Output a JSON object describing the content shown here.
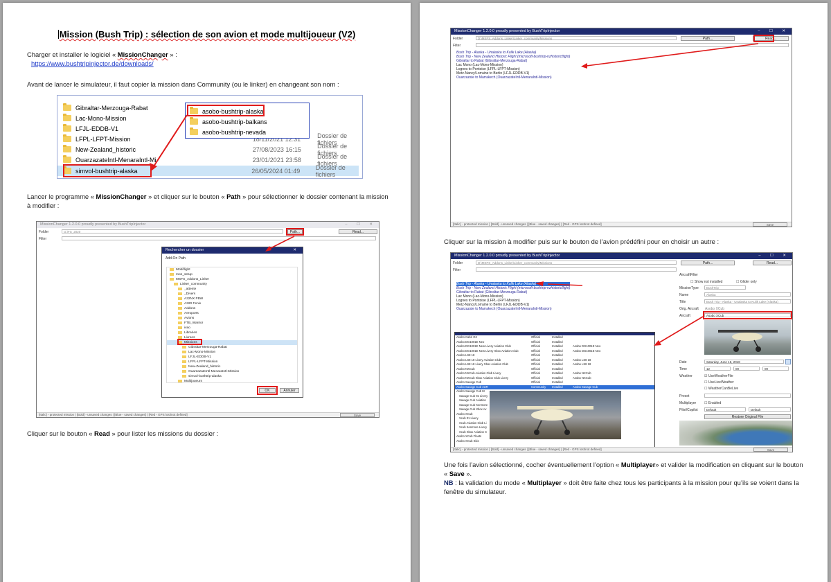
{
  "left_page": {
    "title": "Mission (Bush Trip) : sélection de son avion et mode multijoueur (V2)",
    "intro_prefix": "Charger et installer le logiciel « ",
    "intro_app": "MissionChanger",
    "intro_suffix": " » :",
    "download_url": "https://www.bushtripinjector.de/downloads/",
    "copy_instruction": "Avant de lancer le simulateur, il faut copier la mission dans Community (ou le linker) en changeant son nom :",
    "explorer_rows": [
      {
        "name": "Gibraltar-Merzouga-Rabat",
        "date": "",
        "type": ""
      },
      {
        "name": "Lac-Mono-Mission",
        "date": "",
        "type": ""
      },
      {
        "name": "LFJL-EDDB-V1",
        "date": "",
        "type": ""
      },
      {
        "name": "LFPL-LFPT-Mission",
        "date": "18/11/2021 12:31",
        "type": "Dossier de fichiers"
      },
      {
        "name": "New-Zealand_historic",
        "date": "27/08/2023 16:15",
        "type": "Dossier de fichiers"
      },
      {
        "name": "OuarzazateIntl-MenaraIntl-Mi",
        "date": "23/01/2021 23:58",
        "type": "Dossier de fichiers"
      },
      {
        "name": "simvol-bushtrip-alaska",
        "date": "26/05/2024 01:49",
        "type": "Dossier de fichiers"
      }
    ],
    "explorer_popup": [
      "asobo-bushtrip-alaska",
      "asobo-bushtrip-balkans",
      "asobo-bushtrip-nevada"
    ],
    "path_instruction_1": "Lancer le programme « ",
    "path_app": "MissionChanger",
    "path_instruction_2": " » et cliquer sur le bouton « ",
    "path_button": "Path",
    "path_instruction_3": " » pour sélectionner le dossier contenant la mission à modifier :",
    "read_instruction_1": "Cliquer sur le bouton « ",
    "read_button": "Read",
    "read_instruction_2": " » pour lister les missions du dossier :"
  },
  "app": {
    "window_title": "MissionChanger 1.2.0.0 proudly presented by BushTripInjector",
    "folder_label": "Folder",
    "filter_label": "Filter",
    "folder_value_1": "G:\\FS_2020",
    "folder_value_2": "D:\\MSFS_Addons_Linker\\Linker_community\\Missions",
    "path_btn": "Path...",
    "read_btn": "Read...",
    "save_btn": "Save",
    "status": "[Italic] - protected mission | [Bold] - unsaved changes | [Blue - saved changes] | [Red - GPS lost/not defined]",
    "missions": [
      "Bush Trip - Alaska - Unalaska to Kulik Lake (Alaska)",
      "Bush Trip - New Zealand Historic Flight (microsoft-bushtrip-nzhistoricflight)",
      "Gibraltar to Rabat (Gibraltar-Merzouga-Rabat)",
      "Lac Mono (Lac-Mono-Mission)",
      "Lognes to Pontoise (LFPL-LFPT-Mission)",
      "Metz-Nancy/Lorraine to Berlin (LFJL-EDDB-V1)",
      "Ouarzazate to Marrakech (OuarzazateIntl-MenaraIntl-Mission)"
    ]
  },
  "dialog": {
    "title": "Rechercher un dossier",
    "subtitle": "Add-On Path",
    "tree": [
      "Mobiflight",
      "mon_setup",
      "MSFS_Addons_Linker",
      "Linker_community",
      "_attente",
      "_Divers",
      "A32NX FBW",
      "A320 Fenix",
      "Addons",
      "Aeroports",
      "Avions",
      "FTB_Warrior",
      "ivao",
      "Libraries",
      "Livrees",
      "Missions",
      "Gibraltar-Merzouga-Rabat",
      "Lac-Mono-Mission",
      "LFJL-EDDB-V1",
      "LFPL-LFPT-Mission",
      "New-Zealand_historic",
      "OuarzazateIntl-MenaraIntl-Mission",
      "simvol-bushtrip-alaska",
      "Multijoueurs"
    ],
    "ok": "OK",
    "cancel": "Annuler"
  },
  "right_page": {
    "select_instruction": "Cliquer sur la mission à modifier puis sur le bouton de l’avion prédéfini pour en choisir un autre :",
    "final_1": "Une fois l’avion sélectionné, cocher éventuellement l’option « ",
    "final_option": "Multiplayer",
    "final_2": "» et valider la modification en cliquant sur le bouton « ",
    "final_button": "Save",
    "final_3": " ».",
    "nb_label": "NB",
    "nb_1": " : la validation du mode « ",
    "nb_option": "Multiplayer",
    "nb_2": " » doit être faite chez tous les participants à la mission pour qu’ils se voient dans la fenêtre du simulateur."
  },
  "aircraft_panel": {
    "header": "AircraftFilter",
    "show_not_installed": "Show not installed",
    "glider_only": "Glider only",
    "mission_type_label": "MissionType",
    "mission_type": "BushTrip",
    "name_label": "Name",
    "name": "Alaska",
    "title_label": "Title",
    "title": "Bush Trip - Alaska - Unalaska to Kulik Lake (Alaska)",
    "orig_aircraft_label": "Orig. Aircraft",
    "orig_aircraft": "Asobo XCub",
    "aircraft_label": "Aircraft",
    "aircraft": "Asobo XCub",
    "date_label": "Date",
    "date": "Saturday, June 16, 2018",
    "time_label": "Time",
    "time": [
      "12",
      "00",
      "00"
    ],
    "weather_label": "Weather",
    "use_weather_file": "UseWeatherFile",
    "use_live_weather": "UseLiveWeather",
    "weather_car_be_live": "WeatherCanBeLive",
    "preset_label": "Preset",
    "multiplayer_label": "Multiplayer",
    "enabled": "Enabled",
    "pilot_label": "Pilot/Copilot",
    "pilot": "Default",
    "copilot": "Default",
    "restore_btn": "Restore Original File"
  },
  "aircraft_list": [
    [
      "Asobo Cabri G2",
      "Official",
      "Installed",
      ""
    ],
    [
      "Asobo DG1001E Neo",
      "Official",
      "Installed",
      ""
    ],
    [
      "Asobo DG1001E New Livery Aviation Club",
      "Official",
      "Installed",
      "Asobo DG1001E Neo"
    ],
    [
      "Asobo DG1001E New Livery Xbox Aviation Club",
      "Official",
      "Installed",
      "Asobo DG1001E Neo"
    ],
    [
      "Asobo LS8 18",
      "Official",
      "Installed",
      ""
    ],
    [
      "Asobo LS8 18 Livery Aviation Club",
      "Official",
      "Installed",
      "Asobo LS8 18"
    ],
    [
      "Asobo LS8 18 Livery Xbox Aviation Club",
      "Official",
      "Installed",
      "Asobo LS8 18"
    ],
    [
      "Asobo NXCub",
      "Official",
      "Installed",
      ""
    ],
    [
      "Asobo NXCub Aviation Club Livery",
      "Official",
      "Installed",
      "Asobo NXCub"
    ],
    [
      "Asobo NXCub Xbox Aviation Club Livery",
      "Official",
      "Installed",
      "Asobo NXCub"
    ],
    [
      "Asobo Savage Cub",
      "Official",
      "Installed",
      ""
    ],
    [
      "Asobo Savage Cub 4UR",
      "Community",
      "Installed",
      "Asobo Savage Cub"
    ],
    [
      "Asobo Savage Cub M",
      "",
      "",
      ""
    ],
    [
      "Savage Cub 01 Livery",
      "",
      "",
      ""
    ],
    [
      "Savage Cub Aviation",
      "",
      "",
      ""
    ],
    [
      "Savage Cub Kenmore",
      "",
      "",
      ""
    ],
    [
      "Savage Cub Xbox Av",
      "",
      "",
      ""
    ],
    [
      "Asobo XCub",
      "",
      "",
      ""
    ],
    [
      "Xcub 01 Livery",
      "",
      "",
      ""
    ],
    [
      "Xcub Aviation Club Li",
      "",
      "",
      ""
    ],
    [
      "Xcub Kenmore Livery",
      "",
      "",
      ""
    ],
    [
      "Xcub Xbox Aviation C",
      "",
      "",
      ""
    ],
    [
      "Asobo XCub Floats",
      "",
      "",
      ""
    ],
    [
      "Asobo XCub Skis",
      "",
      "",
      ""
    ]
  ],
  "colors": {
    "title_bar": "#1e2b6f",
    "highlight": "#e01b1b",
    "selection": "#2f6fd6",
    "link": "#1a37c8"
  }
}
